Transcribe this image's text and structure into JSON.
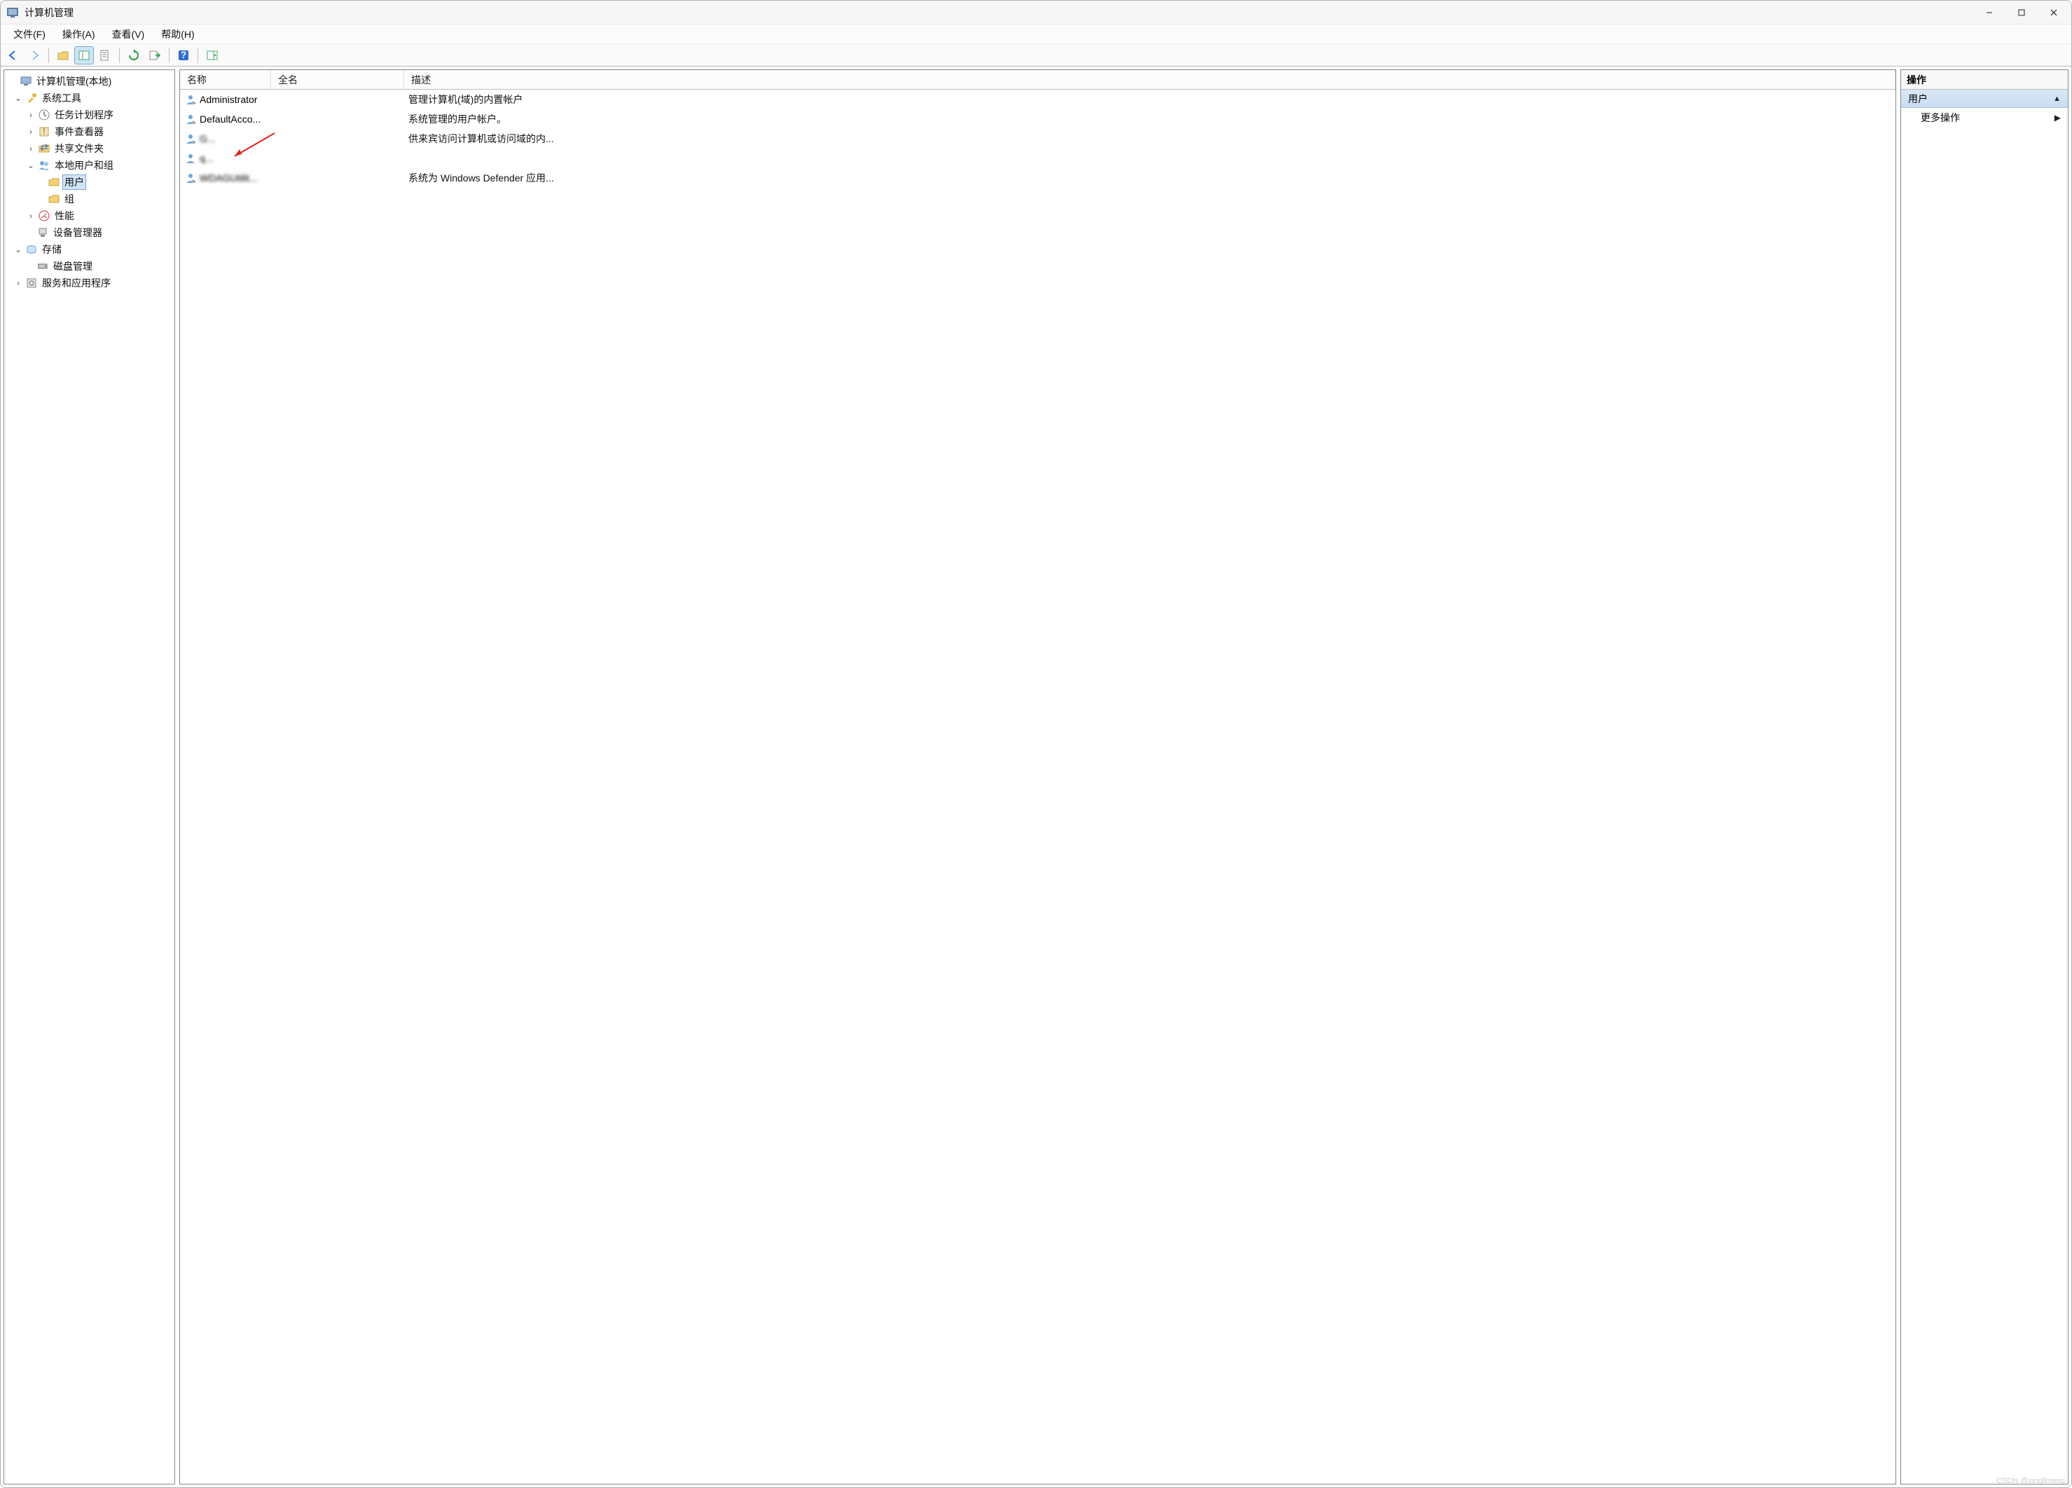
{
  "window": {
    "title": "计算机管理"
  },
  "menu": {
    "file": "文件(F)",
    "action": "操作(A)",
    "view": "查看(V)",
    "help": "帮助(H)"
  },
  "tree": {
    "root": "计算机管理(本地)",
    "sys_tools": "系统工具",
    "task_sched": "任务计划程序",
    "event_viewer": "事件查看器",
    "shared_folders": "共享文件夹",
    "local_users": "本地用户和组",
    "users": "用户",
    "groups": "组",
    "perf": "性能",
    "device_mgr": "设备管理器",
    "storage": "存储",
    "disk_mgmt": "磁盘管理",
    "svcs_apps": "服务和应用程序"
  },
  "list": {
    "col_name": "名称",
    "col_fullname": "全名",
    "col_desc": "描述",
    "rows": [
      {
        "name": "Administrator",
        "full": "",
        "desc": "管理计算机(域)的内置帐户"
      },
      {
        "name": "DefaultAcco...",
        "full": "",
        "desc": "系统管理的用户帐户。"
      },
      {
        "name": "G...",
        "full": "",
        "desc": "供来宾访问计算机或访问域的内..."
      },
      {
        "name": "q...",
        "full": "",
        "desc": ""
      },
      {
        "name": "WDAGUtilit...",
        "full": "",
        "desc": "系统为 Windows Defender 应用..."
      }
    ]
  },
  "actions": {
    "header": "操作",
    "category": "用户",
    "more": "更多操作"
  },
  "watermark": "CSDN @xingllmeng"
}
